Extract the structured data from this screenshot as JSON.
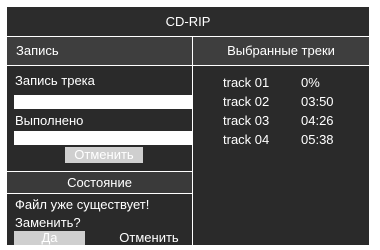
{
  "window": {
    "title": "CD-RIP"
  },
  "header": {
    "left_label": "Запись",
    "right_label": "Выбранные треки"
  },
  "record": {
    "track_label": "Запись трека",
    "track_value": "",
    "done_label": "Выполнено",
    "done_value": "",
    "cancel_label": "Отменить"
  },
  "status": {
    "title": "Состояние",
    "message_line1": "Файл уже существует!",
    "message_line2": "Заменить?",
    "yes_label": "Да",
    "no_label": "Отменить"
  },
  "tracks": [
    {
      "name": "track 01",
      "time": "0%"
    },
    {
      "name": "track 02",
      "time": "03:50"
    },
    {
      "name": "track 03",
      "time": "04:26"
    },
    {
      "name": "track 04",
      "time": "05:38"
    }
  ],
  "colors": {
    "background": "#2a2a2a",
    "header": "#3e3e3e",
    "button": "#cfcfcf",
    "text": "#ffffff"
  }
}
